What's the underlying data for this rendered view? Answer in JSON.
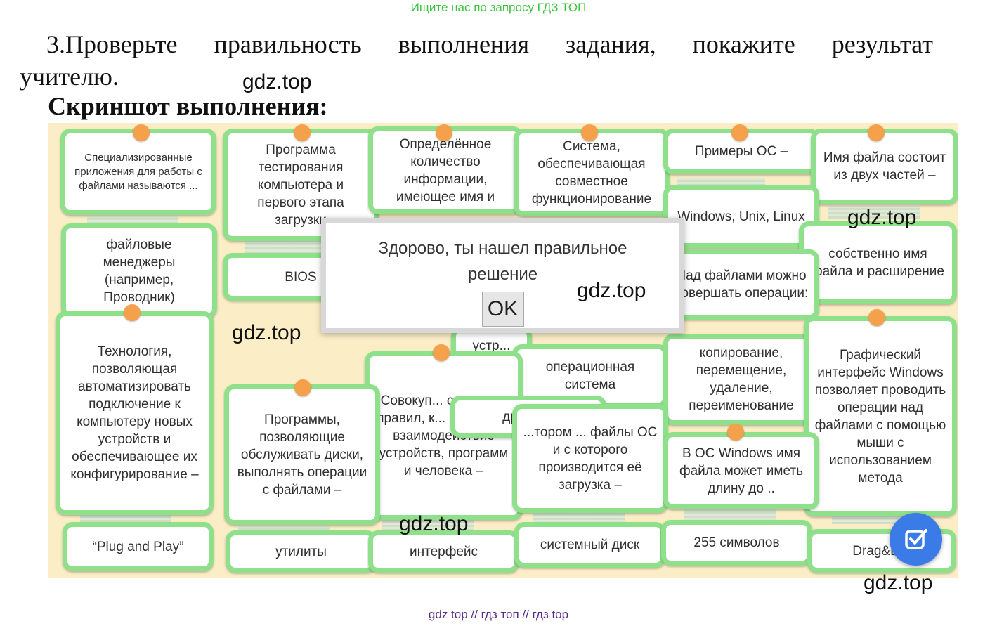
{
  "banner": "Ищите нас по запросу ГДЗ ТОП",
  "task": {
    "words": [
      "3.Проверьте",
      "правильность",
      "выполнения",
      "задания,",
      "покажите",
      "результат"
    ],
    "line2": "учителю."
  },
  "screenshot_title": "Скриншот выполнения:",
  "watermark": "gdz.top",
  "cards": {
    "c1": "Специализированные приложения для работы с файлами называются ...",
    "c2": "Программа тестирования компьютера и первого этапа загрузки",
    "c3": "Определённое количество информации, имеющее имя и",
    "c4": "Система, обеспечивающая совместное функционирование",
    "c5": "Примеры ОС –",
    "c6": "Имя файла состоит из двух частей –",
    "c7": "файловые менеджеры (например, Проводник)",
    "c8": "BIOS",
    "c9": "Windows, Unix, Linux",
    "c10": "собственно имя файла и расширение",
    "c11": "Над файлами можно совершать операции:",
    "c12": "Технология, позволяющая автоматизировать подключение к компьютеру новых устройств и обеспечивающее их конфигурирование –",
    "c13": "устр... ввода",
    "c14": "операционная система",
    "c15": "копирование, перемещение, удаление, переименование",
    "c16": "Графический интерфейс Windows позволяет проводить операции над файлами с помощью мыши с использованием метода",
    "c17": "Совокуп... средств и правил, к... обеспеч... взаимодействие устройств, программ и человека –",
    "c18": "драйвер",
    "c19": "...тором ... файлы ОС и с которого производится её загрузка –",
    "c20": "Программы, позволяющие обслуживать диски, выполнять операции с файлами –",
    "c21": "В ОС Windows имя файла может иметь длину до ..",
    "c22": "“Plug and Play”",
    "c23": "утилиты",
    "c24": "интерфейс",
    "c25": "системный диск",
    "c26": "255 символов",
    "c27": "Drag&D..."
  },
  "dialog": {
    "message": "Здорово, ты нашел правильное решение",
    "ok_label": "OK"
  },
  "close_label": "✕✕",
  "bottom_links": "gdz top  //  гдз топ  //  гдз top",
  "colors": {
    "card_border": "#8fe08a",
    "pin": "#f5a04a",
    "board": "#fbedc6",
    "fab": "#3a7be8"
  },
  "icons": {
    "fab": "check-square-icon"
  }
}
